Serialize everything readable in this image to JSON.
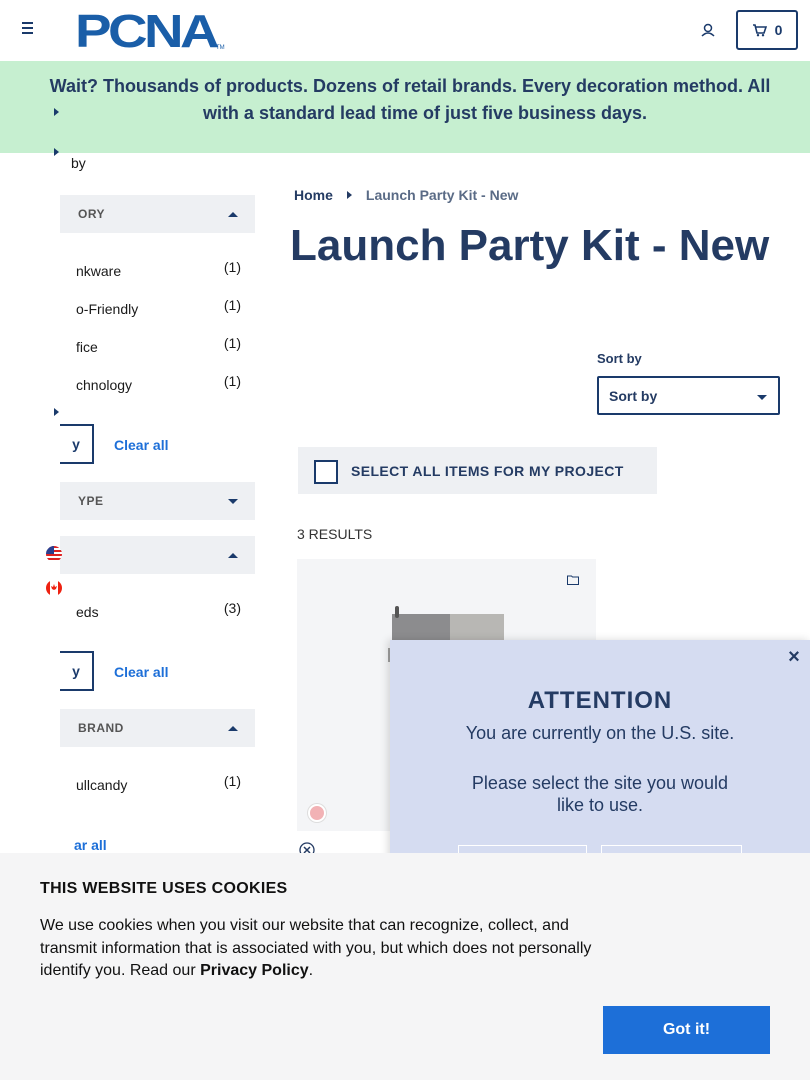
{
  "header": {
    "logo_text": "PCNA",
    "logo_tm": "TM",
    "cart_count": "0"
  },
  "banner": {
    "line1": "Wait? Thousands of products. Dozens of retail brands. Every decoration method. All",
    "line2": "with a standard lead time of just five business days."
  },
  "side_strip": {
    "by_fragment": "by"
  },
  "filters": {
    "category": {
      "title_fragment": "ORY",
      "items": [
        {
          "name": "nkware",
          "count": "(1)"
        },
        {
          "name": "o-Friendly",
          "count": "(1)"
        },
        {
          "name": "fice",
          "count": "(1)"
        },
        {
          "name": "chnology",
          "count": "(1)"
        }
      ],
      "apply_fragment": "y",
      "clear_label": "Clear all"
    },
    "type": {
      "title_fragment": "YPE"
    },
    "third": {
      "title_fragment": "",
      "items": [
        {
          "name": "eds",
          "count": "(3)"
        }
      ],
      "apply_fragment": "y",
      "clear_label": "Clear all"
    },
    "brand": {
      "title_fragment": "BRAND",
      "items": [
        {
          "name": "ullcandy",
          "count": "(1)"
        }
      ],
      "clear_fragment": "ar all"
    }
  },
  "breadcrumb": {
    "home": "Home",
    "current": "Launch Party Kit - New"
  },
  "page": {
    "title": "Launch Party Kit - New",
    "sort_label": "Sort by",
    "sort_value": "Sort by",
    "select_all_label": "SELECT ALL ITEMS FOR MY PROJECT",
    "results": "3 RESULTS"
  },
  "product": {
    "swatch_color": "#f2b2b5"
  },
  "modal": {
    "title": "ATTENTION",
    "line1": "You are currently on the U.S. site.",
    "line2": "Please select the site you would like to use.",
    "close": "×"
  },
  "cookie": {
    "title": "THIS WEBSITE USES COOKIES",
    "text": "We use cookies when you visit our website that can recognize, collect, and transmit information that is associated with you, but which does not personally identify you. Read our",
    "link": "Privacy Policy",
    "period": ".",
    "button": "Got it!"
  },
  "colors": {
    "brand_navy": "#243b63",
    "banner_green": "#c6efd0",
    "link_blue": "#1d6fd8",
    "modal_bg": "#d5dcf1"
  }
}
